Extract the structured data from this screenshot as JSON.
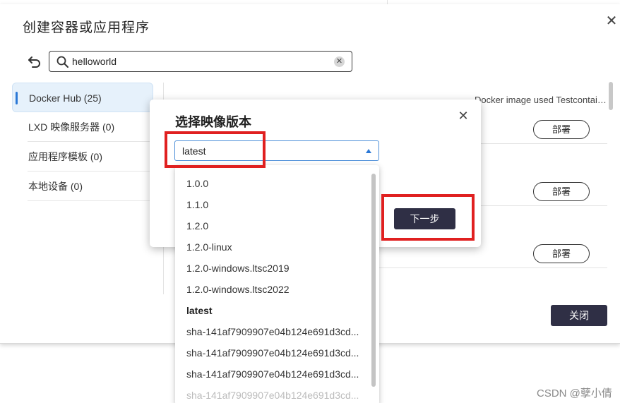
{
  "main": {
    "title": "创建容器或应用程序",
    "search": {
      "value": "helloworld"
    },
    "close_label": "关闭"
  },
  "sidebar": {
    "items": [
      {
        "label": "Docker Hub (25)"
      },
      {
        "label": "LXD 映像服务器 (0)"
      },
      {
        "label": "应用程序模板 (0)"
      },
      {
        "label": "本地设备 (0)"
      }
    ]
  },
  "results": [
    {
      "description": "Docker image used Testcontainers' self-test suit...",
      "deploy_label": "部署"
    },
    {
      "description": "",
      "deploy_label": "部署"
    },
    {
      "description": "",
      "deploy_label": "部署"
    }
  ],
  "version_modal": {
    "title": "选择映像版本",
    "selected": "latest",
    "next_label": "下一步"
  },
  "dropdown": {
    "options": [
      "1.0.0",
      "1.1.0",
      "1.2.0",
      "1.2.0-linux",
      "1.2.0-windows.ltsc2019",
      "1.2.0-windows.ltsc2022",
      "latest",
      "sha-141af7909907e04b124e691d3cd...",
      "sha-141af7909907e04b124e691d3cd...",
      "sha-141af7909907e04b124e691d3cd...",
      "sha-141af7909907e04b124e691d3cd..."
    ]
  },
  "watermark": "CSDN @孽小倩",
  "colors": {
    "accent": "#2b78d6",
    "primary_button": "#2f2f45",
    "annotation": "#e02020"
  }
}
